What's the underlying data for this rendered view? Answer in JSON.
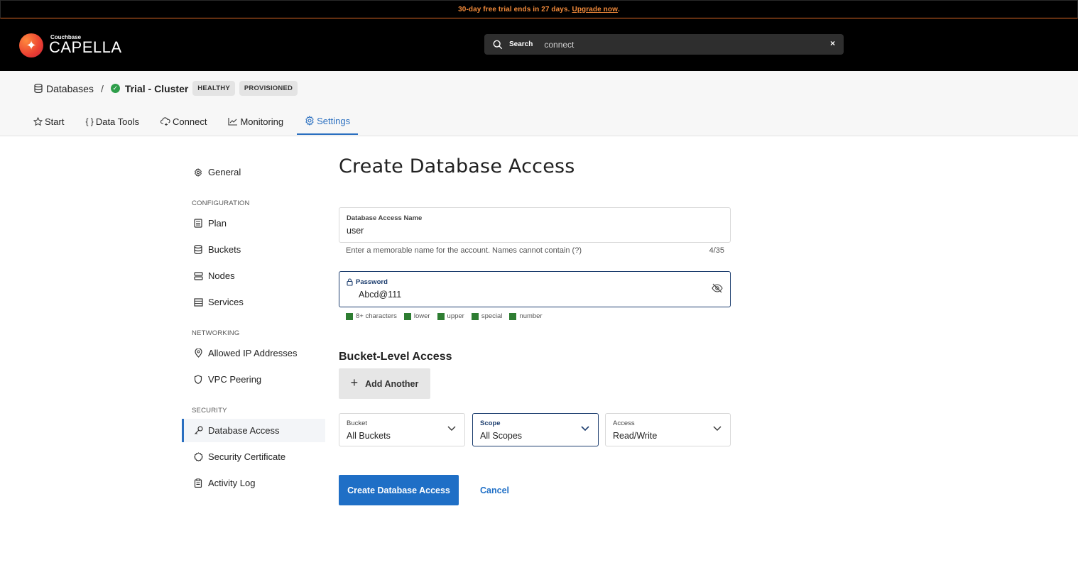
{
  "banner": {
    "text": "30-day free trial ends in 27 days.",
    "link": "Upgrade now",
    "suffix": "."
  },
  "brand": {
    "sub": "Couchbase",
    "name": "CAPELLA",
    "accent": "#ea3f32"
  },
  "search": {
    "label": "Search",
    "value": "connect",
    "clear": "×"
  },
  "breadcrumb": {
    "root": "Databases",
    "separator": "/",
    "cluster": "Trial - Cluster",
    "badges": [
      "HEALTHY",
      "PROVISIONED"
    ],
    "status_color": "#2e9e4a"
  },
  "tabs": [
    {
      "label": "Start",
      "icon": "star-icon"
    },
    {
      "label": "Data Tools",
      "icon": "braces-icon"
    },
    {
      "label": "Connect",
      "icon": "cloud-link-icon"
    },
    {
      "label": "Monitoring",
      "icon": "line-chart-icon"
    },
    {
      "label": "Settings",
      "icon": "gear-icon",
      "active": true
    }
  ],
  "sidenav": {
    "general": "General",
    "sections": [
      {
        "title": "CONFIGURATION",
        "items": [
          "Plan",
          "Buckets",
          "Nodes",
          "Services"
        ]
      },
      {
        "title": "NETWORKING",
        "items": [
          "Allowed IP Addresses",
          "VPC Peering"
        ]
      },
      {
        "title": "SECURITY",
        "items": [
          "Database Access",
          "Security Certificate",
          "Activity Log"
        ]
      }
    ],
    "active": "Database Access"
  },
  "form": {
    "title": "Create Database Access",
    "name_field": {
      "label": "Database Access Name",
      "value": "user",
      "helper": "Enter a memorable name for the account. Names cannot contain (?)",
      "counter": "4/35"
    },
    "password_field": {
      "label": "Password",
      "value": "Abcd@111"
    },
    "password_rules": [
      "8+ characters",
      "lower",
      "upper",
      "special",
      "number"
    ],
    "rule_color": "#2e7d32",
    "bucket_section": "Bucket-Level Access",
    "add_another": "Add Another",
    "selects": [
      {
        "label": "Bucket",
        "value": "All Buckets"
      },
      {
        "label": "Scope",
        "value": "All Scopes",
        "focused": true
      },
      {
        "label": "Access",
        "value": "Read/Write"
      }
    ],
    "submit": "Create Database Access",
    "cancel": "Cancel",
    "primary_color": "#1f6fc6"
  }
}
